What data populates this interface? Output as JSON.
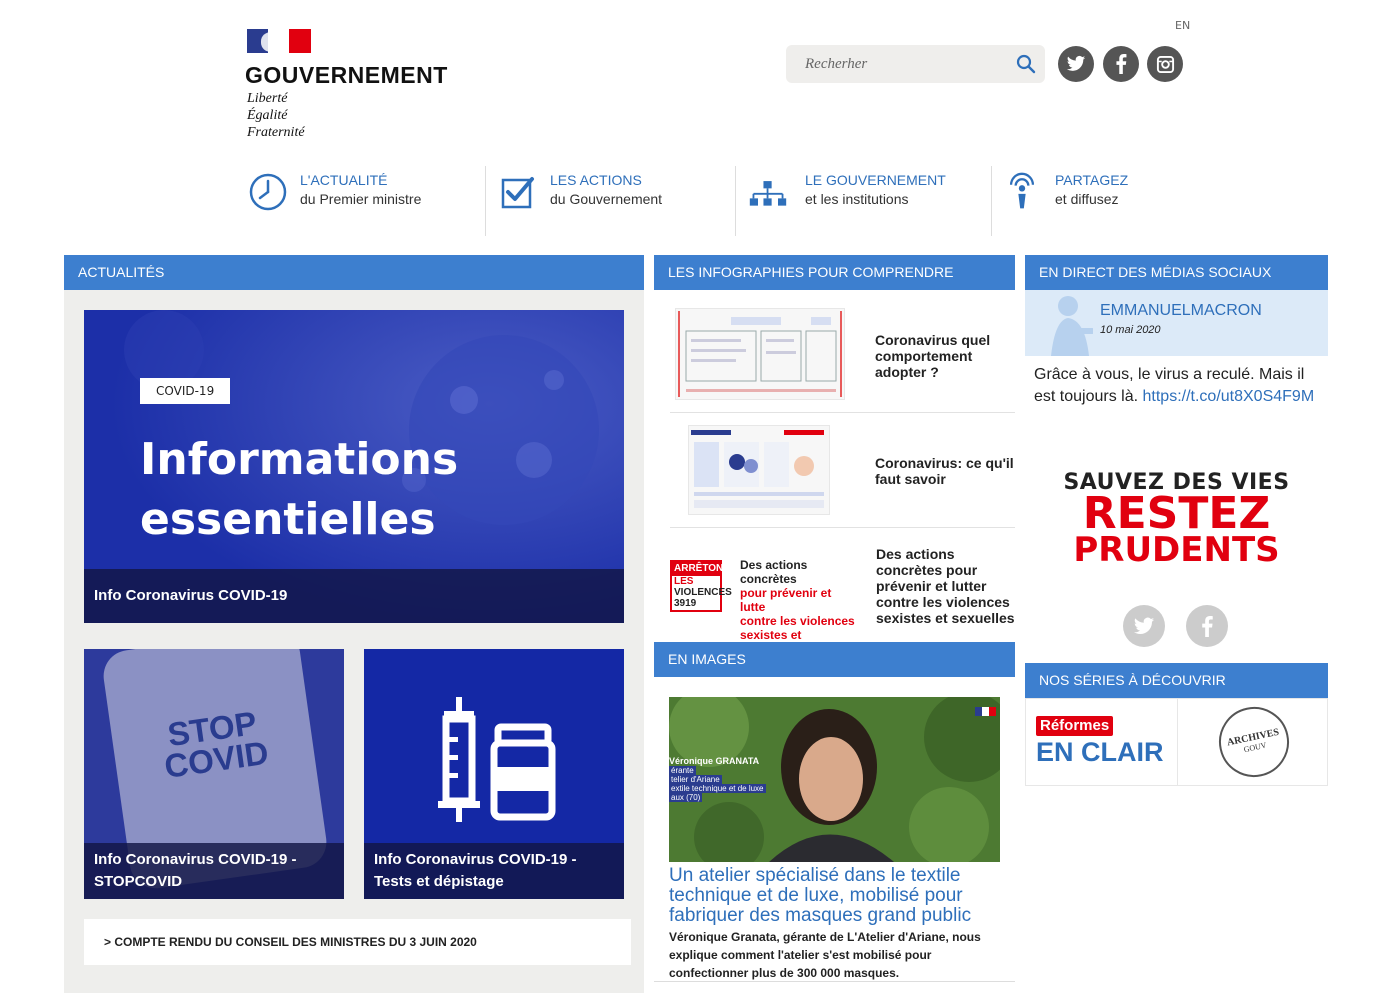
{
  "header": {
    "logo_title": "GOUVERNEMENT",
    "motto": [
      "Liberté",
      "Égalité",
      "Fraternité"
    ],
    "lang": "EN",
    "search_placeholder": "Recherher"
  },
  "nav": [
    {
      "top": "L'ACTUALITÉ",
      "sub": "du Premier ministre",
      "icon": "clock-icon"
    },
    {
      "top": "LES ACTIONS",
      "sub": "du Gouvernement",
      "icon": "checkbox-icon"
    },
    {
      "top": "LE GOUVERNEMENT",
      "sub": "et les institutions",
      "icon": "org-chart-icon"
    },
    {
      "top": "PARTAGEZ",
      "sub": "et diffusez",
      "icon": "broadcast-icon"
    }
  ],
  "sections": {
    "actualites": "ACTUALITÉS",
    "infographies": "LES INFOGRAPHIES POUR COMPRENDRE",
    "reseaux": "EN DIRECT DES MÉDIAS SOCIAUX",
    "images": "EN IMAGES",
    "series": "NOS SÉRIES À DÉCOUVRIR"
  },
  "actualites": {
    "main": {
      "tag": "COVID-19",
      "big_line1": "Informations",
      "big_line2": "essentielles",
      "caption": "Info Coronavirus COVID-19"
    },
    "stopcovid": {
      "art_line1": "STOP",
      "art_line2": "COVID",
      "caption": "Info Coronavirus COVID-19 - STOPCOVID"
    },
    "tests": {
      "caption": "Info Coronavirus COVID-19 - Tests et dépistage"
    },
    "compte_rendu": "> COMPTE RENDU DU CONSEIL DES MINISTRES DU 3 JUIN 2020"
  },
  "infographies": [
    {
      "title": "Coronavirus quel comportement adopter ?"
    },
    {
      "title": "Coronavirus: ce qu'il faut savoir"
    },
    {
      "title": "Des actions concrètes pour prévenir et lutter contre les violences sexistes et sexuelles",
      "thumb_badge": [
        "ARRÊTONS",
        "LES",
        "VIOLENCES",
        "3919"
      ],
      "thumb_text": [
        "Des actions concrètes",
        "pour prévenir et lutte",
        "contre les violences",
        "sexistes et sexuelles"
      ]
    }
  ],
  "en_images": {
    "overlay": [
      "Véronique GRANATA",
      "érante",
      "telier d'Ariane",
      "extile technique et de luxe",
      "aux (70)"
    ],
    "title": "Un atelier spécialisé dans le textile technique et de luxe, mobilisé pour fabriquer des masques grand public",
    "desc": "Véronique Granata, gérante de L'Atelier d'Ariane, nous explique comment l'atelier s'est mobilisé pour confectionner plus de 300 000 masques."
  },
  "reseaux": {
    "name": "EMMANUELMACRON",
    "date": "10 mai 2020",
    "text": "Grâce à vous, le virus a reculé. Mais il est toujours là. ",
    "link": "https://t.co/ut8X0S4F9M",
    "banner": [
      "SAUVEZ DES VIES",
      "RESTEZ",
      "PRUDENTS"
    ]
  },
  "series": {
    "reformes_tag": "Réformes",
    "reformes_main": "EN CLAIR",
    "archives": [
      "ARCHIVES",
      "GOUV"
    ]
  },
  "colors": {
    "accent": "#3d7fcf",
    "link": "#2e6fba",
    "covid_blue": "#1c2fa8",
    "red": "#e1000f"
  }
}
